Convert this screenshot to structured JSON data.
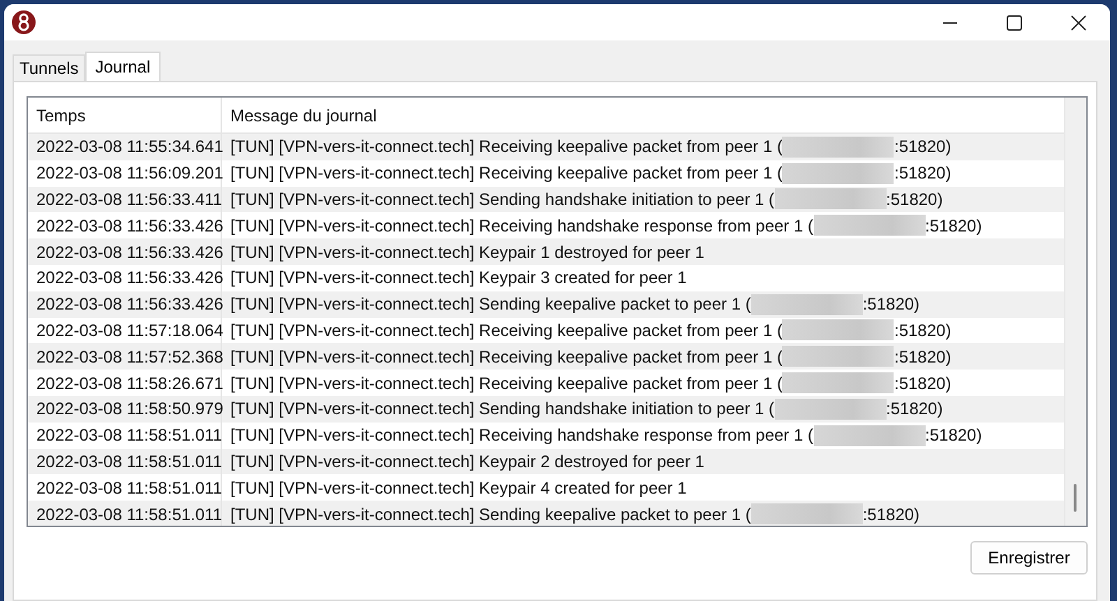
{
  "tabs": [
    {
      "label": "Tunnels",
      "selected": false
    },
    {
      "label": "Journal",
      "selected": true
    }
  ],
  "table": {
    "columns": [
      "Temps",
      "Message du journal"
    ],
    "rows": [
      {
        "time": "2022-03-08 11:55:34.641",
        "message": "[TUN] [VPN-vers-it-connect.tech] Receiving keepalive packet from peer 1 (",
        "redacted": true,
        "suffix": ":51820)"
      },
      {
        "time": "2022-03-08 11:56:09.201",
        "message": "[TUN] [VPN-vers-it-connect.tech] Receiving keepalive packet from peer 1 (",
        "redacted": true,
        "suffix": ":51820)"
      },
      {
        "time": "2022-03-08 11:56:33.411",
        "message": "[TUN] [VPN-vers-it-connect.tech] Sending handshake initiation to peer 1 (",
        "redacted": true,
        "suffix": ":51820)"
      },
      {
        "time": "2022-03-08 11:56:33.426",
        "message": "[TUN] [VPN-vers-it-connect.tech] Receiving handshake response from peer 1 (",
        "redacted": true,
        "suffix": ":51820)"
      },
      {
        "time": "2022-03-08 11:56:33.426",
        "message": "[TUN] [VPN-vers-it-connect.tech] Keypair 1 destroyed for peer 1",
        "redacted": false
      },
      {
        "time": "2022-03-08 11:56:33.426",
        "message": "[TUN] [VPN-vers-it-connect.tech] Keypair 3 created for peer 1",
        "redacted": false
      },
      {
        "time": "2022-03-08 11:56:33.426",
        "message": "[TUN] [VPN-vers-it-connect.tech] Sending keepalive packet to peer 1 (",
        "redacted": true,
        "suffix": ":51820)"
      },
      {
        "time": "2022-03-08 11:57:18.064",
        "message": "[TUN] [VPN-vers-it-connect.tech] Receiving keepalive packet from peer 1 (",
        "redacted": true,
        "suffix": ":51820)"
      },
      {
        "time": "2022-03-08 11:57:52.368",
        "message": "[TUN] [VPN-vers-it-connect.tech] Receiving keepalive packet from peer 1 (",
        "redacted": true,
        "suffix": ":51820)"
      },
      {
        "time": "2022-03-08 11:58:26.671",
        "message": "[TUN] [VPN-vers-it-connect.tech] Receiving keepalive packet from peer 1 (",
        "redacted": true,
        "suffix": ":51820)"
      },
      {
        "time": "2022-03-08 11:58:50.979",
        "message": "[TUN] [VPN-vers-it-connect.tech] Sending handshake initiation to peer 1 (",
        "redacted": true,
        "suffix": ":51820)"
      },
      {
        "time": "2022-03-08 11:58:51.011",
        "message": "[TUN] [VPN-vers-it-connect.tech] Receiving handshake response from peer 1 (",
        "redacted": true,
        "suffix": ":51820)"
      },
      {
        "time": "2022-03-08 11:58:51.011",
        "message": "[TUN] [VPN-vers-it-connect.tech] Keypair 2 destroyed for peer 1",
        "redacted": false
      },
      {
        "time": "2022-03-08 11:58:51.011",
        "message": "[TUN] [VPN-vers-it-connect.tech] Keypair 4 created for peer 1",
        "redacted": false
      },
      {
        "time": "2022-03-08 11:58:51.011",
        "message": "[TUN] [VPN-vers-it-connect.tech] Sending keepalive packet to peer 1 (",
        "redacted": true,
        "suffix": ":51820)"
      }
    ]
  },
  "buttons": [
    "Enregistrer"
  ]
}
